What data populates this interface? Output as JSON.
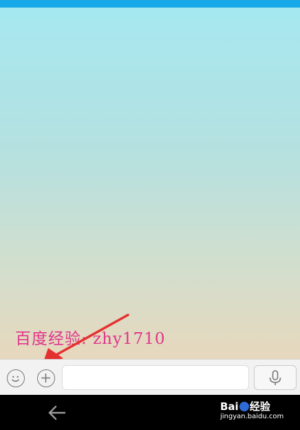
{
  "colors": {
    "status_strip": "#1aa9e8",
    "watermark_text": "#e0358a",
    "arrow": "#e53030",
    "input_bar": "#f2f2f3",
    "nav_bar": "#000000"
  },
  "chat": {
    "watermark_text": "百度经验: zhy1710"
  },
  "input_bar": {
    "emoji_icon": "smiley-icon",
    "plus_icon": "plus-icon",
    "message_value": "",
    "voice_icon": "microphone-icon"
  },
  "nav": {
    "back_icon": "back-arrow-icon"
  },
  "watermark_logo": {
    "main_before": "Bai",
    "main_after": "经验",
    "sub": "jingyan.baidu.com"
  }
}
